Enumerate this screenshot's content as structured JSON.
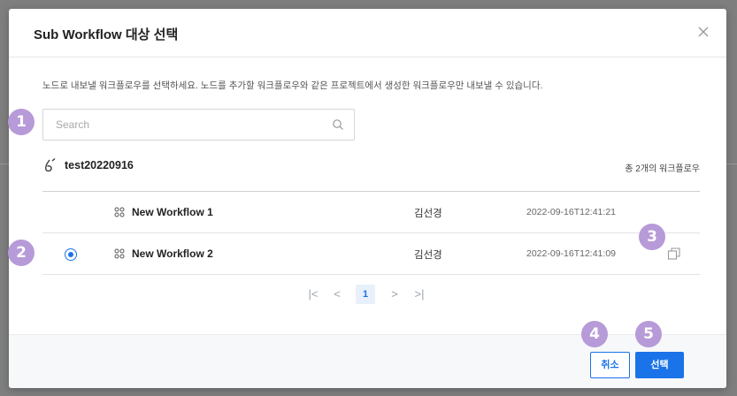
{
  "dialog": {
    "title": "Sub Workflow 대상 선택",
    "description": "노드로 내보낼 워크플로우를 선택하세요. 노드를 추가할 워크플로우와 같은 프로젝트에서 생성한 워크플로우만 내보낼 수 있습니다."
  },
  "search": {
    "placeholder": "Search",
    "value": ""
  },
  "project": {
    "name": "test20220916",
    "count_text": "총 2개의 워크플로우"
  },
  "workflows": [
    {
      "name": "New Workflow 1",
      "author": "김선경",
      "created": "2022-09-16T12:41:21",
      "selected": false
    },
    {
      "name": "New Workflow 2",
      "author": "김선경",
      "created": "2022-09-16T12:41:09",
      "selected": true
    }
  ],
  "pagination": {
    "first": "|<",
    "prev": "<",
    "current": "1",
    "next": ">",
    "last": ">|"
  },
  "footer": {
    "cancel_label": "취소",
    "select_label": "선택"
  },
  "badges": [
    "1",
    "2",
    "3",
    "4",
    "5"
  ],
  "colors": {
    "accent": "#1a73e8",
    "badge": "#b79ad8"
  }
}
